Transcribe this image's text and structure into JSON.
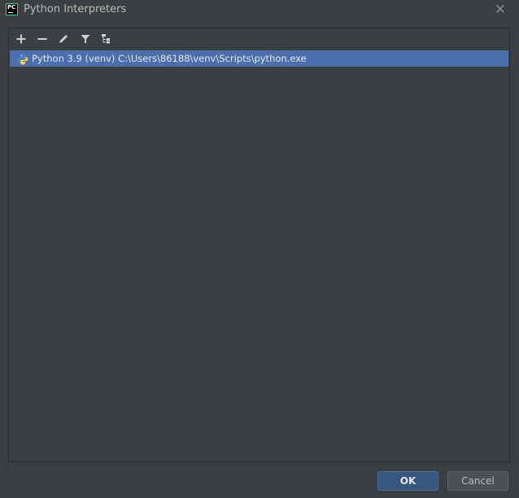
{
  "window": {
    "title": "Python Interpreters",
    "close_glyph": "✕",
    "app_icon_text": "PC"
  },
  "toolbar": {
    "actions": [
      {
        "name": "add",
        "icon": "plus-icon"
      },
      {
        "name": "remove",
        "icon": "minus-icon"
      },
      {
        "name": "edit",
        "icon": "pencil-icon"
      },
      {
        "name": "filter",
        "icon": "filter-icon"
      },
      {
        "name": "show-paths",
        "icon": "tree-icon"
      }
    ]
  },
  "interpreters": [
    {
      "label": "Python 3.9 (venv) C:\\Users\\86188\\venv\\Scripts\\python.exe",
      "icon": "python-icon",
      "selected": true
    }
  ],
  "buttons": {
    "ok": "OK",
    "cancel": "Cancel"
  },
  "colors": {
    "background": "#3c3f41",
    "selection": "#4b6eaf",
    "ok_button": "#365880",
    "app_icon_accent": "#21d789"
  }
}
